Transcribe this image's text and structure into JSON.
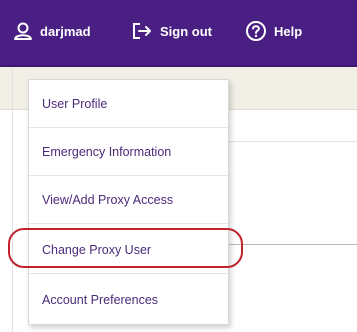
{
  "header": {
    "username": "darjmad",
    "signout_label": "Sign out",
    "help_label": "Help"
  },
  "menu": {
    "items": [
      {
        "label": "User Profile"
      },
      {
        "label": "Emergency Information"
      },
      {
        "label": "View/Add Proxy Access"
      },
      {
        "label": "Change Proxy User"
      },
      {
        "label": "Account Preferences"
      }
    ],
    "highlighted": "Change Proxy User"
  },
  "colors": {
    "header_bg": "#4a1f83",
    "menu_text": "#4a2b7a",
    "highlight_ring": "#c0232e"
  },
  "icons": {
    "user": "user-icon",
    "signout": "sign-out-icon",
    "help": "help-icon"
  }
}
